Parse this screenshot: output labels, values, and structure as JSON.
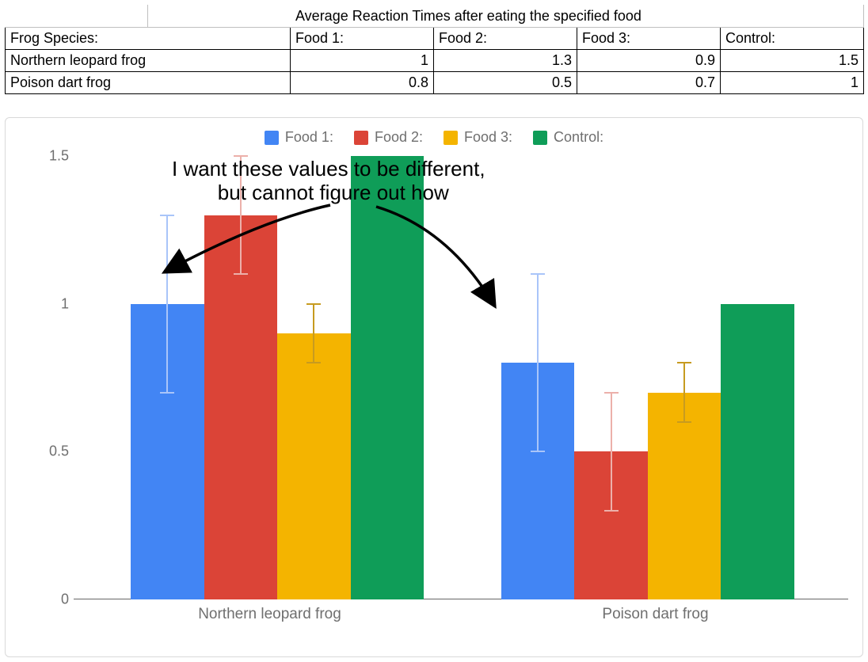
{
  "table": {
    "merge_header": "Average Reaction Times after eating the specified food",
    "row_header": "Frog Species:",
    "cols": [
      "Food 1:",
      "Food 2:",
      "Food 3:",
      "Control:"
    ],
    "rows": [
      {
        "label": "Northern leopard frog",
        "vals": [
          "1",
          "1.3",
          "0.9",
          "1.5"
        ]
      },
      {
        "label": "Poison dart frog",
        "vals": [
          "0.8",
          "0.5",
          "0.7",
          "1"
        ]
      }
    ]
  },
  "chart_data": {
    "type": "bar",
    "categories": [
      "Northern leopard frog",
      "Poison dart frog"
    ],
    "series": [
      {
        "name": "Food 1:",
        "color": "#4285F4",
        "err_color": "#a9c5f9",
        "values": [
          1.0,
          0.8
        ],
        "errors": [
          0.3,
          0.3
        ]
      },
      {
        "name": "Food 2:",
        "color": "#DB4437",
        "err_color": "#ecb0aa",
        "values": [
          1.3,
          0.5
        ],
        "errors": [
          0.2,
          0.2
        ]
      },
      {
        "name": "Food 3:",
        "color": "#F4B400",
        "err_color": "#c79b20",
        "values": [
          0.9,
          0.7
        ],
        "errors": [
          0.1,
          0.1
        ]
      },
      {
        "name": "Control:",
        "color": "#0F9D58",
        "err_color": "#0F9D58",
        "values": [
          1.5,
          1.0
        ],
        "errors": [
          0,
          0
        ]
      }
    ],
    "ylim": [
      0,
      1.5
    ],
    "yticks": [
      "0",
      "0.5",
      "1",
      "1.5"
    ],
    "xlabel": "",
    "ylabel": ""
  },
  "annotation": {
    "line1": "I want these values to be different,",
    "line2": "        but cannot figure out how"
  }
}
